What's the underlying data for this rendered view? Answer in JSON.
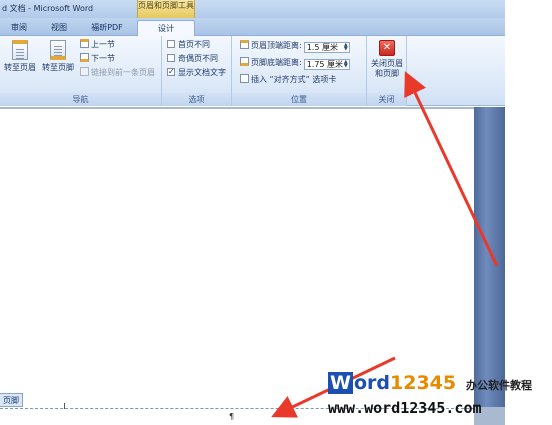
{
  "window": {
    "doc_title": "d 文档 - Microsoft Word",
    "context_tab_label": "页眉和页脚工具"
  },
  "tabs": [
    {
      "label": "审阅",
      "active": false
    },
    {
      "label": "视图",
      "active": false
    },
    {
      "label": "福昕PDF",
      "active": false
    },
    {
      "label": "设计",
      "active": true
    }
  ],
  "ribbon": {
    "nav": {
      "label": "导航",
      "goto_header": "转至页眉",
      "goto_footer": "转至页脚",
      "prev_section": "上一节",
      "next_section": "下一节",
      "link_previous": "链接到前一条页眉"
    },
    "options": {
      "label": "选项",
      "items": [
        {
          "text": "首页不同",
          "checked": false
        },
        {
          "text": "奇偶页不同",
          "checked": false
        },
        {
          "text": "显示文档文字",
          "checked": true
        }
      ]
    },
    "position": {
      "label": "位置",
      "header_dist_label": "页眉顶端距离:",
      "header_dist_value": "1.5 厘米",
      "footer_dist_label": "页脚底端距离:",
      "footer_dist_value": "1.75 厘米",
      "insert_align_tab": "插入 “对齐方式” 选项卡"
    },
    "close": {
      "label": "关闭",
      "button_line1": "关闭页眉",
      "button_line2": "和页脚"
    }
  },
  "document": {
    "footer_tag": "页脚"
  },
  "watermark": {
    "logo_w": "W",
    "logo_ord": "ord",
    "logo_digits": "12345",
    "tagline": "办公软件教程",
    "url": "www.word12345.com"
  },
  "colors": {
    "arrow": "#e8392b",
    "accent_blue": "#1b4fb0",
    "close_red": "#c9281d"
  }
}
